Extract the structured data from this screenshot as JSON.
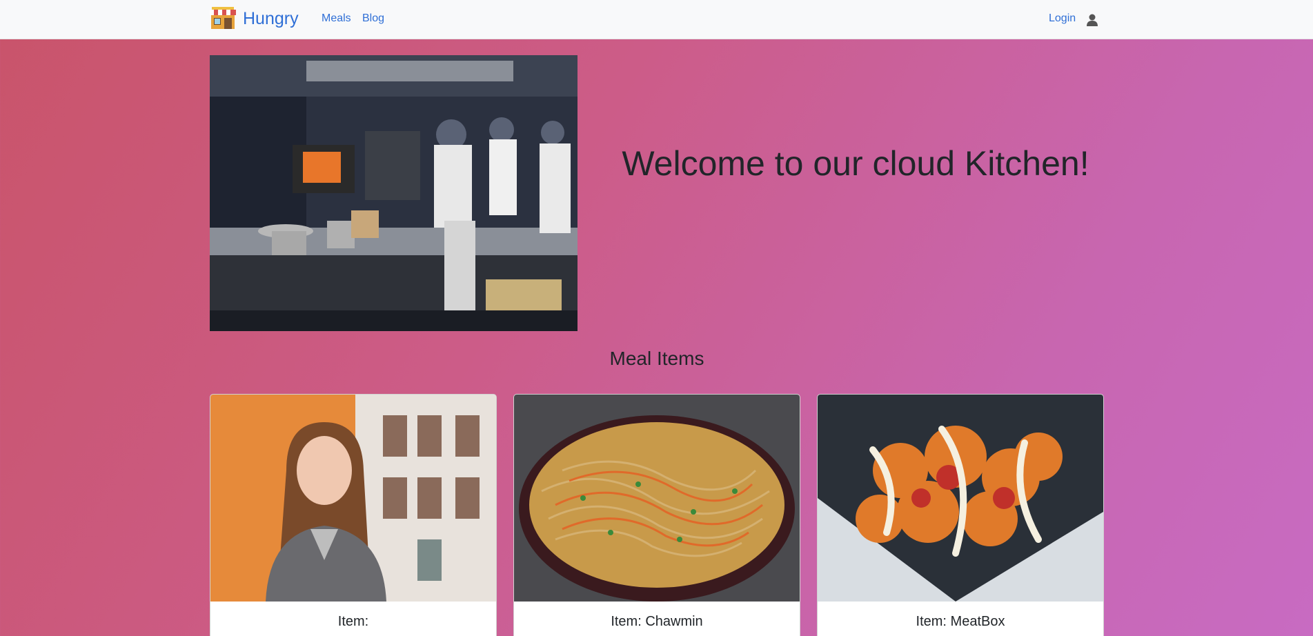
{
  "navbar": {
    "brand": "Hungry",
    "links": [
      "Meals",
      "Blog"
    ],
    "login": "Login",
    "logo_icon": "storefront-logo",
    "user_icon": "user-icon"
  },
  "hero": {
    "title": "Welcome to our cloud Kitchen!",
    "image": "kitchen-chefs-photo"
  },
  "meals": {
    "section_title": "Meal Items",
    "items": [
      {
        "title": "Item:",
        "image": "woman-portrait-photo"
      },
      {
        "title": "Item: Chawmin",
        "image": "noodles-pan-photo"
      },
      {
        "title": "Item: MeatBox",
        "image": "fried-chicken-box-photo"
      }
    ]
  },
  "colors": {
    "navbar_bg": "#f8f9fa",
    "link": "#2f6fd6",
    "gradient_start": "#c9546a",
    "gradient_end": "#c86bc2"
  }
}
